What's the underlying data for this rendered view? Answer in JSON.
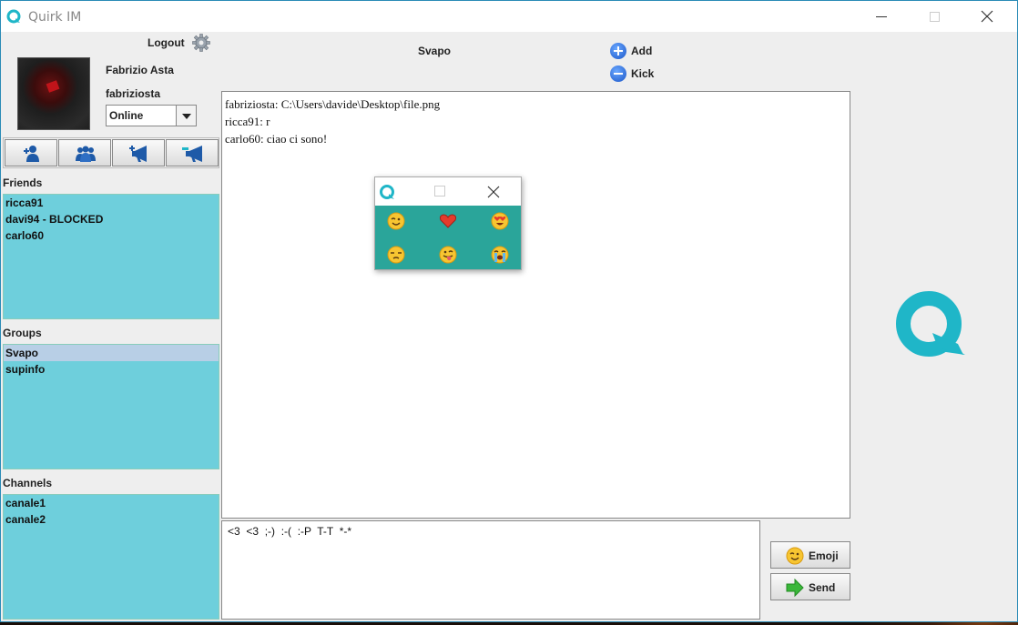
{
  "window": {
    "title": "Quirk IM"
  },
  "profile": {
    "logout_label": "Logout",
    "display_name": "Fabrizio Asta",
    "username": "fabriziosta",
    "status": "Online"
  },
  "sections": {
    "friends_label": "Friends",
    "groups_label": "Groups",
    "channels_label": "Channels"
  },
  "friends": [
    "ricca91",
    "davi94 - BLOCKED",
    "carlo60"
  ],
  "groups": [
    {
      "name": "Svapo",
      "selected": true
    },
    {
      "name": "supinfo",
      "selected": false
    }
  ],
  "channels": [
    "canale1",
    "canale2"
  ],
  "header": {
    "group_name": "Svapo",
    "add_label": "Add",
    "kick_label": "Kick"
  },
  "messages": [
    "fabriziosta: C:\\Users\\davide\\Desktop\\file.png",
    "ricca91: r",
    "carlo60: ciao ci sono!"
  ],
  "compose": {
    "text": "<3  <3  ;-)  :-(  :-P  T-T  *-*"
  },
  "buttons": {
    "emoji_label": "Emoji",
    "send_label": "Send"
  },
  "emoji_popup": {
    "emojis": [
      "wink-emoji",
      "heart-emoji",
      "heart-eyes-emoji",
      "unamused-emoji",
      "tongue-emoji",
      "crying-emoji"
    ]
  },
  "colors": {
    "list_bg": "#6ecfdc",
    "accent": "#1fb6c8",
    "popup_bg": "#2aa59a"
  }
}
